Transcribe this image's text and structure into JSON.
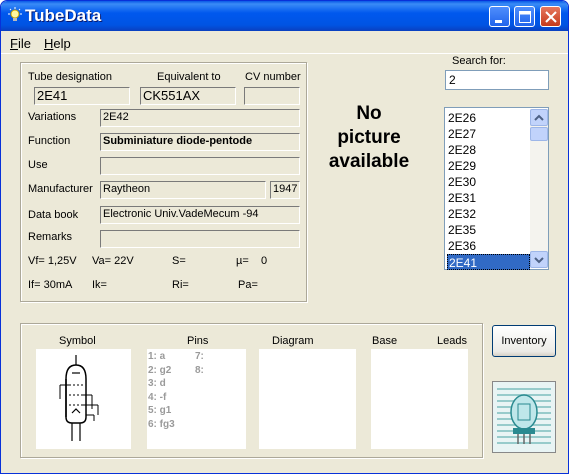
{
  "window": {
    "title": "TubeData"
  },
  "menu": {
    "file": "File",
    "file_mnemonic": "F",
    "file_rest": "ile",
    "help": "Help",
    "help_mnemonic": "H",
    "help_rest": "elp"
  },
  "details": {
    "tube_designation_label": "Tube designation",
    "tube_designation": "2E41",
    "equivalent_label": "Equivalent to",
    "equivalent": "CK551AX",
    "cv_label": "CV number",
    "cv_number": "",
    "variations_label": "Variations",
    "variations": "2E42",
    "function_label": "Function",
    "function": "Subminiature diode-pentode",
    "use_label": "Use",
    "use": "",
    "manufacturer_label": "Manufacturer",
    "manufacturer": "Raytheon",
    "year": "1947",
    "databook_label": "Data book",
    "databook": "Electronic Univ.VadeMecum -94",
    "remarks_label": "Remarks",
    "remarks": "",
    "vf": "Vf= 1,25V",
    "va": "Va= 22V",
    "s": "S=",
    "mu": "µ=",
    "mu_value": "0",
    "if": "If= 30mA",
    "ik": "Ik=",
    "ri": "Ri=",
    "pa": "Pa="
  },
  "picture": {
    "no_picture_line1": "No",
    "no_picture_line2": "picture",
    "no_picture_line3": "available"
  },
  "search": {
    "label": "Search for:",
    "value": "2"
  },
  "tube_list": {
    "items": [
      "2E26",
      "2E27",
      "2E28",
      "2E29",
      "2E30",
      "2E31",
      "2E32",
      "2E35",
      "2E36",
      "2E41"
    ],
    "selected": "2E41"
  },
  "bottom": {
    "symbol_label": "Symbol",
    "pins_label": "Pins",
    "diagram_label": "Diagram",
    "base_label": "Base",
    "leads_label": "Leads",
    "pins_left": [
      "1: a",
      "2: g2",
      "3: d",
      "4: -f",
      "5: g1",
      "6: fg3"
    ],
    "pins_right": [
      "7:",
      "8:"
    ]
  },
  "inventory_button": "Inventory",
  "colors": {
    "titlebar": "#0054e3",
    "window_bg": "#ece9d8",
    "selection": "#316ac5"
  },
  "icons": {
    "app_icon": "lightbulb-icon",
    "minimize": "minimize-icon",
    "maximize": "maximize-icon",
    "close": "close-icon",
    "scroll_up": "scroll-up-icon",
    "scroll_down": "scroll-down-icon"
  }
}
